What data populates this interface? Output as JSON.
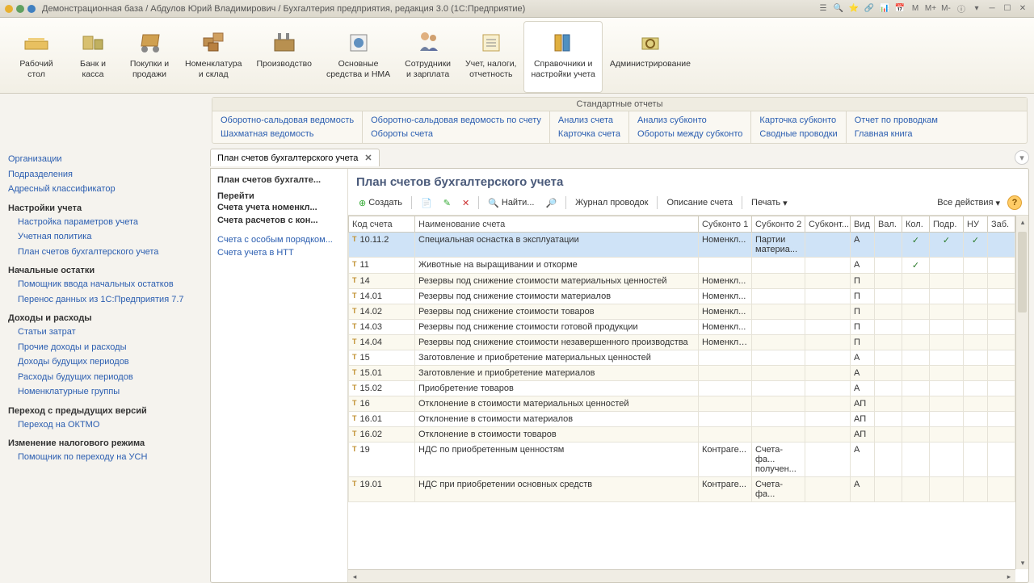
{
  "titlebar": {
    "text": "Демонстрационная база / Абдулов Юрий Владимирович / Бухгалтерия предприятия, редакция 3.0  (1С:Предприятие)",
    "menu_m": "M",
    "menu_mplus": "M+",
    "menu_mminus": "M-"
  },
  "ribbon": [
    {
      "label": "Рабочий\nстол"
    },
    {
      "label": "Банк и\nкасса"
    },
    {
      "label": "Покупки и\nпродажи"
    },
    {
      "label": "Номенклатура\nи склад"
    },
    {
      "label": "Производство"
    },
    {
      "label": "Основные\nсредства и НМА"
    },
    {
      "label": "Сотрудники\nи зарплата"
    },
    {
      "label": "Учет, налоги,\nотчетность"
    },
    {
      "label": "Справочники и\nнастройки учета"
    },
    {
      "label": "Администрирование"
    }
  ],
  "reports": {
    "title": "Стандартные отчеты",
    "cols": [
      [
        "Оборотно-сальдовая ведомость",
        "Шахматная ведомость"
      ],
      [
        "Оборотно-сальдовая ведомость по счету",
        "Обороты счета"
      ],
      [
        "Анализ счета",
        "Карточка счета"
      ],
      [
        "Анализ субконто",
        "Обороты между субконто"
      ],
      [
        "Карточка субконто",
        "Сводные проводки"
      ],
      [
        "Отчет по проводкам",
        "Главная книга"
      ]
    ]
  },
  "sidebar": {
    "g0": [
      "Организации",
      "Подразделения",
      "Адресный классификатор"
    ],
    "h1": "Настройки учета",
    "g1": [
      "Настройка параметров учета",
      "Учетная политика",
      "План счетов бухгалтерского учета"
    ],
    "h2": "Начальные остатки",
    "g2": [
      "Помощник ввода начальных остатков",
      "Перенос данных из 1С:Предприятия 7.7"
    ],
    "h3": "Доходы и расходы",
    "g3": [
      "Статьи затрат",
      "Прочие доходы и расходы",
      "Доходы будущих периодов",
      "Расходы будущих периодов",
      "Номенклатурные группы"
    ],
    "h4": "Переход с предыдущих версий",
    "g4": [
      "Переход на ОКТМО"
    ],
    "h5": "Изменение налогового режима",
    "g5": [
      "Помощник по переходу на УСН"
    ]
  },
  "tab": {
    "label": "План счетов бухгалтерского учета",
    "close": "✕"
  },
  "ws_side": {
    "i0": "План счетов бухгалте...",
    "h1": "Перейти",
    "i1": "Счета учета номенкл...",
    "i2": "Счета расчетов с кон...",
    "i3": "Счета с особым порядком...",
    "i4": "Счета учета в НТТ"
  },
  "ws_title": "План счетов бухгалтерского учета",
  "toolbar": {
    "create": "Создать",
    "find": "Найти...",
    "journal": "Журнал проводок",
    "desc": "Описание счета",
    "print": "Печать",
    "all": "Все действия"
  },
  "columns": [
    "Код счета",
    "Наименование счета",
    "Субконто 1",
    "Субконто 2",
    "Субконт...",
    "Вид",
    "Вал.",
    "Кол.",
    "Подр.",
    "НУ",
    "Заб."
  ],
  "rows": [
    {
      "code": "10.11.2",
      "name": "Специальная оснастка в эксплуатации",
      "s1": "Номенкл...",
      "s2": "Партии материа...",
      "vid": "А",
      "kol": "✓",
      "podr": "✓",
      "nu": "✓",
      "sel": true
    },
    {
      "code": "11",
      "name": "Животные на выращивании и откорме",
      "vid": "А",
      "kol": "✓"
    },
    {
      "code": "14",
      "name": "Резервы под снижение стоимости материальных ценностей",
      "s1": "Номенкл...",
      "vid": "П",
      "alt": true
    },
    {
      "code": "14.01",
      "name": "Резервы под снижение стоимости материалов",
      "s1": "Номенкл...",
      "vid": "П"
    },
    {
      "code": "14.02",
      "name": "Резервы под снижение стоимости товаров",
      "s1": "Номенкл...",
      "vid": "П",
      "alt": true
    },
    {
      "code": "14.03",
      "name": "Резервы под снижение стоимости готовой продукции",
      "s1": "Номенкл...",
      "vid": "П"
    },
    {
      "code": "14.04",
      "name": "Резервы под снижение стоимости незавершенного производства",
      "s1": "Номенкл... группы",
      "vid": "П",
      "alt": true
    },
    {
      "code": "15",
      "name": "Заготовление и приобретение материальных ценностей",
      "vid": "А"
    },
    {
      "code": "15.01",
      "name": "Заготовление и приобретение материалов",
      "vid": "А",
      "alt": true
    },
    {
      "code": "15.02",
      "name": "Приобретение товаров",
      "vid": "А"
    },
    {
      "code": "16",
      "name": "Отклонение в стоимости материальных ценностей",
      "vid": "АП",
      "alt": true
    },
    {
      "code": "16.01",
      "name": "Отклонение в стоимости материалов",
      "vid": "АП"
    },
    {
      "code": "16.02",
      "name": "Отклонение в стоимости товаров",
      "vid": "АП",
      "alt": true
    },
    {
      "code": "19",
      "name": "НДС по приобретенным ценностям",
      "s1": "Контраге...",
      "s2": "Счета-фа... получен...",
      "vid": "А"
    },
    {
      "code": "19.01",
      "name": "НДС при приобретении основных средств",
      "s1": "Контраге...",
      "s2": "Счета-фа...",
      "vid": "А",
      "alt": true
    }
  ],
  "icons": {
    "desk": "#e8c060",
    "bank": "#d8b050",
    "cart": "#c89040",
    "box": "#b88030",
    "factory": "#a87020",
    "asset": "#6090c0",
    "people": "#7080a0",
    "tax": "#c0a050",
    "folder": "#e0b040",
    "gear": "#8090a0"
  }
}
